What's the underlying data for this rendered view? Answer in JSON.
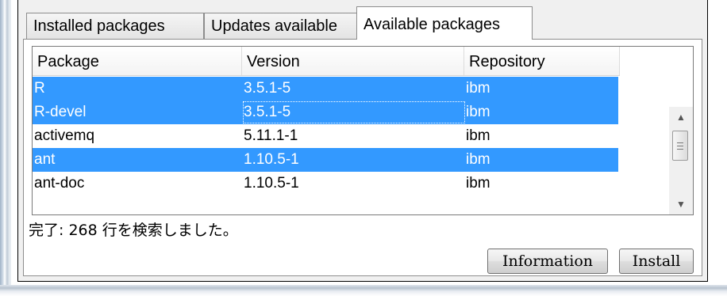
{
  "tabs": [
    {
      "label": "Installed packages",
      "selected": false
    },
    {
      "label": "Updates available",
      "selected": false
    },
    {
      "label": "Available packages",
      "selected": true
    }
  ],
  "table": {
    "columns": [
      "Package",
      "Version",
      "Repository"
    ],
    "rows": [
      {
        "package": "R",
        "version": "3.5.1-5",
        "repository": "ibm",
        "selected": true
      },
      {
        "package": "R-devel",
        "version": "3.5.1-5",
        "repository": "ibm",
        "selected": true
      },
      {
        "package": "activemq",
        "version": "5.11.1-1",
        "repository": "ibm",
        "selected": false
      },
      {
        "package": "ant",
        "version": "1.10.5-1",
        "repository": "ibm",
        "selected": true
      },
      {
        "package": "ant-doc",
        "version": "1.10.5-1",
        "repository": "ibm",
        "selected": false
      }
    ]
  },
  "status": "完了: 268 行を検索しました。",
  "buttons": {
    "information": "Information",
    "install": "Install"
  },
  "colors": {
    "selection": "#3399ff",
    "selection_text": "#ffffff"
  }
}
